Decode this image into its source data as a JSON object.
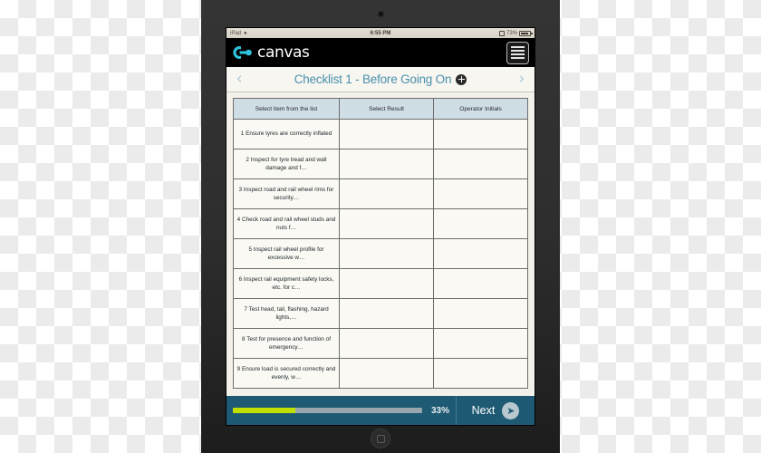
{
  "status_bar": {
    "carrier": "iPad",
    "wifi_icon": "wifi-icon",
    "time": "6:55 PM",
    "sync_icon": "sync-icon",
    "battery_percent": "73%",
    "battery_icon": "battery-icon"
  },
  "app_header": {
    "logo_text": "canvas",
    "logo_icon": "canvas-logo-icon",
    "menu_icon": "hamburger-menu-icon"
  },
  "title_bar": {
    "prev_icon": "chevron-left-icon",
    "title": "Checklist 1 - Before Going On",
    "add_icon": "plus-circle-icon",
    "next_icon": "chevron-right-icon"
  },
  "table": {
    "columns": [
      "Select item from the list",
      "Select Result",
      "Operator Initials"
    ],
    "rows": [
      {
        "item": "1 Ensure tyres are correctly inflated",
        "result": "",
        "initials": ""
      },
      {
        "item": "2 Inspect for tyre tread and wall damage and f…",
        "result": "",
        "initials": ""
      },
      {
        "item": "3 Inspect road and rail wheel rims for security…",
        "result": "",
        "initials": ""
      },
      {
        "item": "4 Check road and rail wheel studs and nuts f…",
        "result": "",
        "initials": ""
      },
      {
        "item": "5 Inspect rail wheel profile for excessive w…",
        "result": "",
        "initials": ""
      },
      {
        "item": "6 Inspect rail equipment safety locks, etc. for c…",
        "result": "",
        "initials": ""
      },
      {
        "item": "7 Test head, tail, flashing, hazard lights,…",
        "result": "",
        "initials": ""
      },
      {
        "item": "8 Test for presence and function of emergency…",
        "result": "",
        "initials": ""
      },
      {
        "item": "9 Ensure load is secured correctly and evenly, w…",
        "result": "",
        "initials": ""
      }
    ]
  },
  "footer": {
    "progress_percent": "33%",
    "progress_value": 33,
    "next_label": "Next",
    "next_icon": "chevron-right-circle-icon"
  },
  "device": {
    "camera_icon": "front-camera-icon",
    "home_button_icon": "home-button-icon"
  },
  "colors": {
    "accent_blue": "#4a90ac",
    "footer_blue": "#1e5a73",
    "progress_green": "#c2e000",
    "header_cell_blue": "#cfdde5",
    "logo_cyan": "#2ec4dd"
  }
}
